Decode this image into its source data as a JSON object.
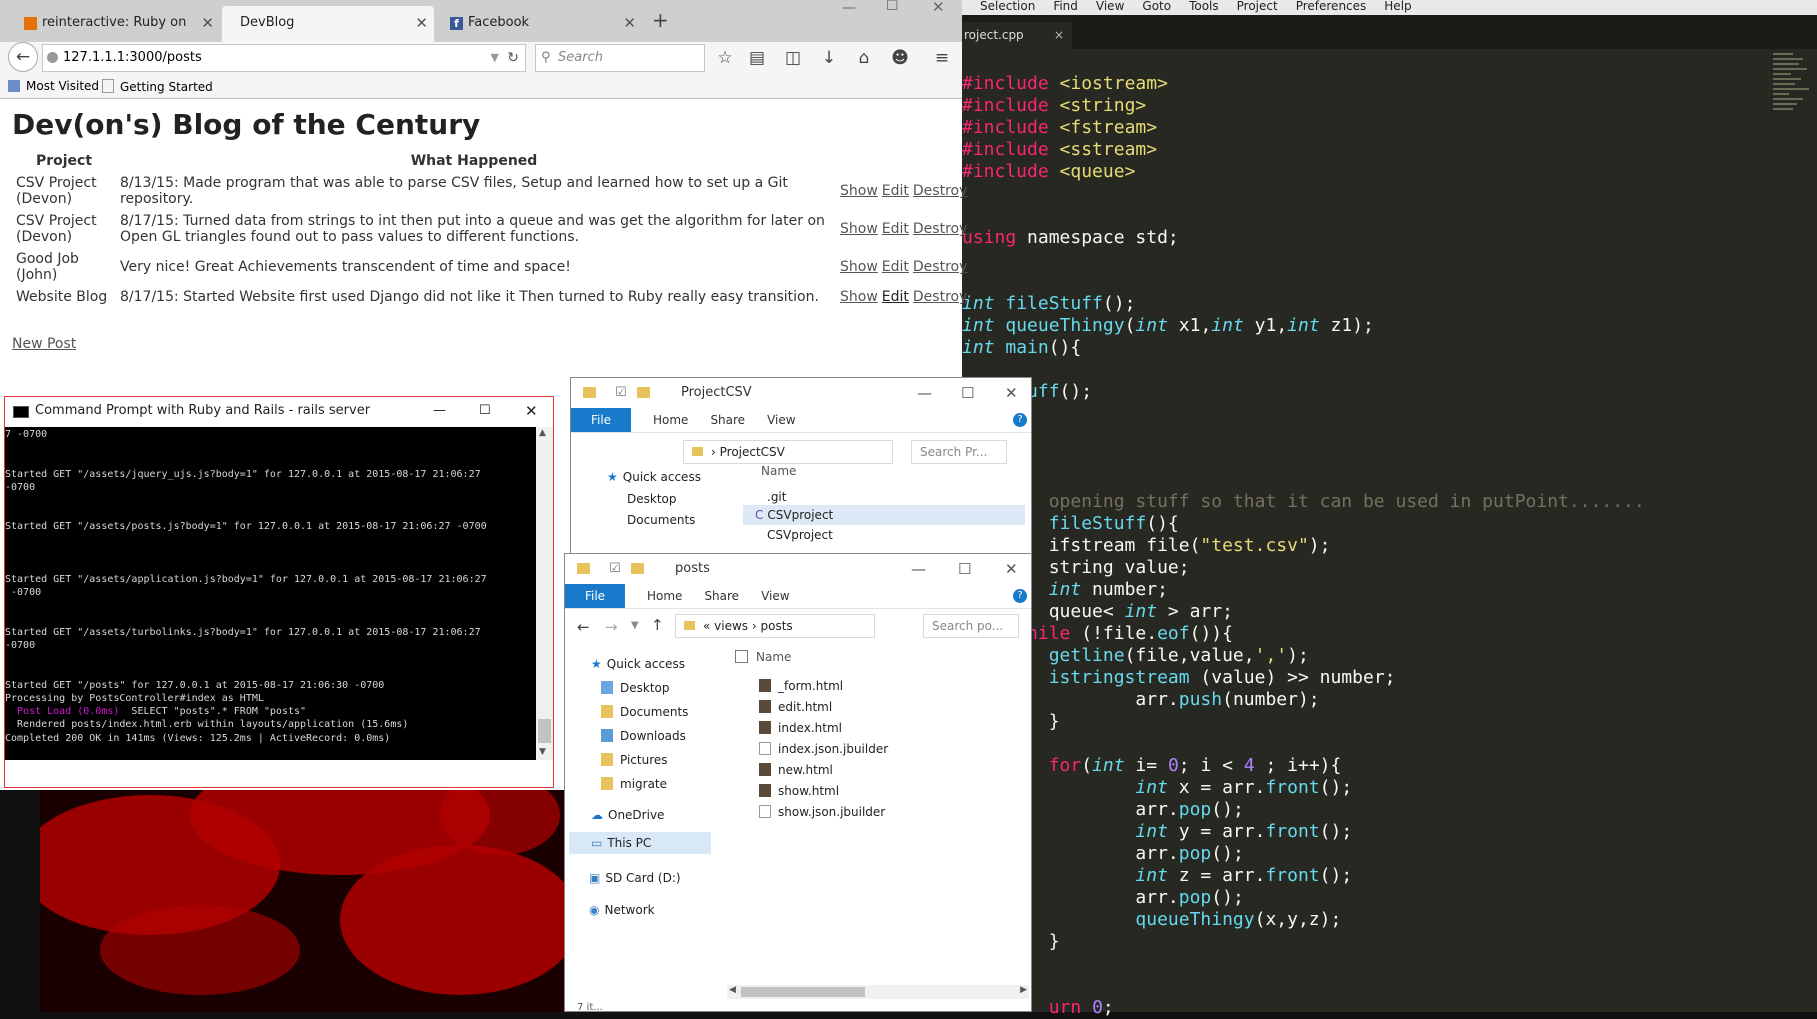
{
  "firefox": {
    "tabs": [
      {
        "label": "reinteractive: Ruby on Rail..."
      },
      {
        "label": "DevBlog"
      },
      {
        "label": "Facebook"
      }
    ],
    "url": "127.1.1.1:3000/posts",
    "search_placeholder": "Search",
    "bookmarks": [
      "Most Visited",
      "Getting Started"
    ],
    "page": {
      "title": "Dev(on's) Blog of the Century",
      "headers": [
        "Project",
        "What Happened"
      ],
      "rows": [
        {
          "project": "CSV Project (Devon)",
          "happened": "8/13/15: Made program that was able to parse CSV files, Setup and learned how to set up a Git repository."
        },
        {
          "project": "CSV Project (Devon)",
          "happened": "8/17/15: Turned data from strings to int then put into a queue and was get the algorithm for later on Open GL triangles found out to pass values to different functions."
        },
        {
          "project": "Good Job (John)",
          "happened": "Very nice! Great Achievements transcendent of time and space!"
        },
        {
          "project": "Website Blog",
          "happened": "8/17/15: Started Website first used Django did not like it Then turned to Ruby really easy transition."
        }
      ],
      "actions": [
        "Show",
        "Edit",
        "Destroy"
      ],
      "new_post": "New Post"
    }
  },
  "cmd": {
    "title": "Command Prompt with Ruby and Rails - rails  server",
    "lines": [
      "7 -0700",
      "",
      "",
      "Started GET \"/assets/jquery_ujs.js?body=1\" for 127.0.0.1 at 2015-08-17 21:06:27",
      "-0700",
      "",
      "",
      "Started GET \"/assets/posts.js?body=1\" for 127.0.0.1 at 2015-08-17 21:06:27 -0700",
      "",
      "",
      "",
      "Started GET \"/assets/application.js?body=1\" for 127.0.0.1 at 2015-08-17 21:06:27",
      " -0700",
      "",
      "",
      "Started GET \"/assets/turbolinks.js?body=1\" for 127.0.0.1 at 2015-08-17 21:06:27",
      "-0700",
      "",
      "",
      "Started GET \"/posts\" for 127.0.0.1 at 2015-08-17 21:06:30 -0700",
      "Processing by PostsController#index as HTML",
      "  Post Load (0.0ms)  SELECT \"posts\".* FROM \"posts\"",
      "  Rendered posts/index.html.erb within layouts/application (15.6ms)",
      "Completed 200 OK in 141ms (Views: 125.2ms | ActiveRecord: 0.0ms)"
    ]
  },
  "explorer_back": {
    "title": "ProjectCSV",
    "ribbon": [
      "File",
      "Home",
      "Share",
      "View"
    ],
    "address": "ProjectCSV",
    "search": "Search Pr...",
    "nav": [
      "Quick access",
      "Desktop",
      "Documents"
    ],
    "column": "Name",
    "files": [
      ".git",
      "CSVproject",
      "CSVproject"
    ]
  },
  "explorer_front": {
    "title": "posts",
    "ribbon": [
      "File",
      "Home",
      "Share",
      "View"
    ],
    "address": [
      "«",
      "views",
      "posts"
    ],
    "search": "Search po...",
    "nav": [
      "Quick access",
      "Desktop",
      "Documents",
      "Downloads",
      "Pictures",
      "migrate",
      "OneDrive",
      "This PC",
      "SD Card (D:)",
      "Network"
    ],
    "column": "Name",
    "files": [
      "_form.html",
      "edit.html",
      "index.html",
      "index.json.jbuilder",
      "new.html",
      "show.html",
      "show.json.jbuilder"
    ],
    "status": "7 it..."
  },
  "sublime": {
    "menu": [
      "Selection",
      "Find",
      "View",
      "Goto",
      "Tools",
      "Project",
      "Preferences",
      "Help"
    ],
    "tab": "roject.cpp"
  },
  "colors": {
    "sublime_bg": "#272822",
    "keyword": "#f92672",
    "type": "#66d9ef",
    "string": "#e6db74",
    "number": "#ae81ff",
    "explorer_file_tab": "#1979ca"
  }
}
